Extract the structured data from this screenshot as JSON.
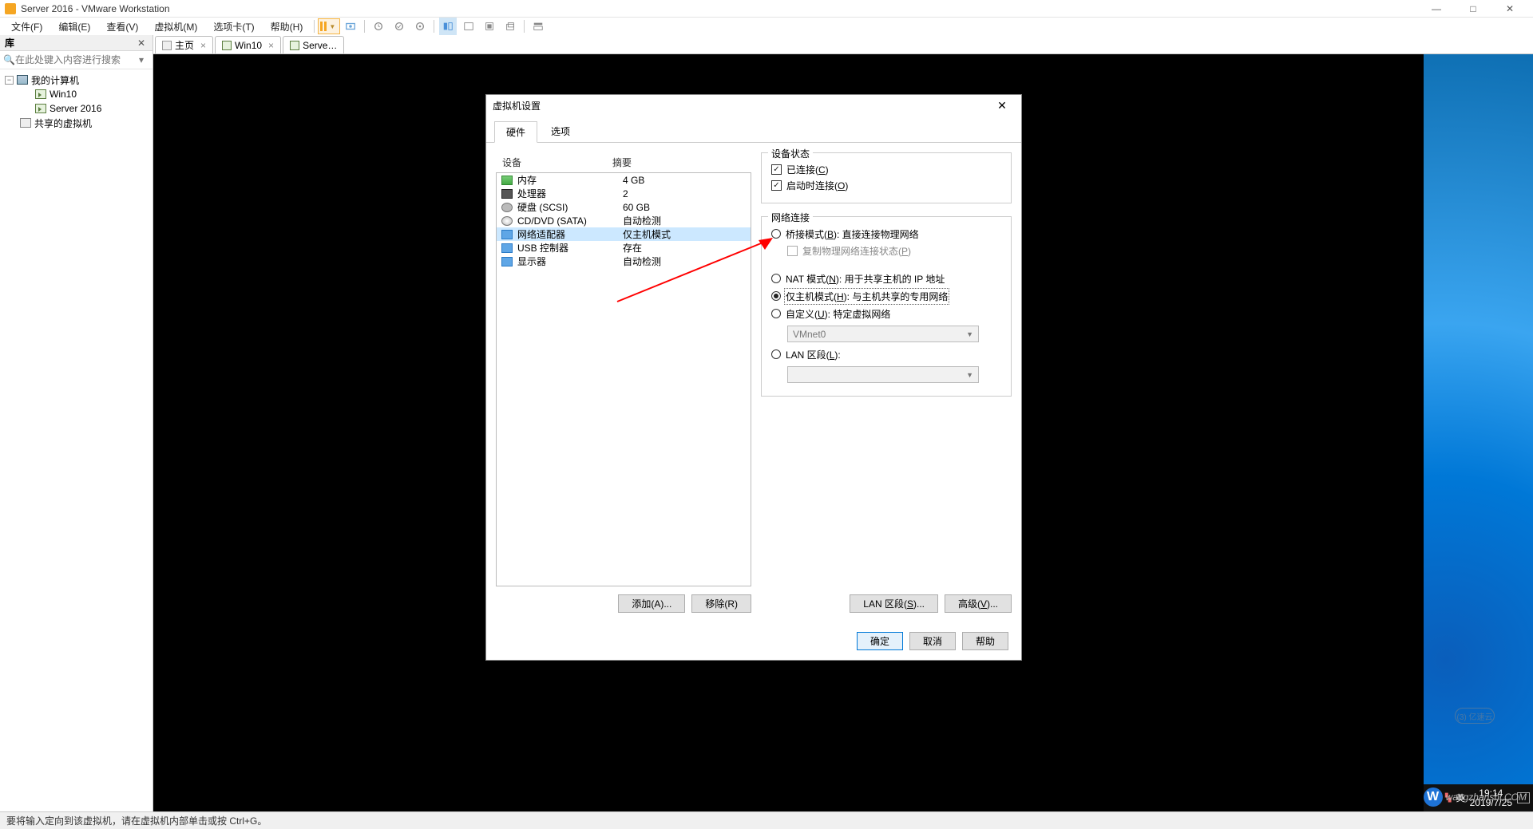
{
  "window": {
    "title": "Server 2016 - VMware Workstation",
    "min": "—",
    "max": "□",
    "close": "✕"
  },
  "menu": {
    "items": [
      "文件(F)",
      "编辑(E)",
      "查看(V)",
      "虚拟机(M)",
      "选项卡(T)",
      "帮助(H)"
    ]
  },
  "library": {
    "header": "库",
    "header_close": "✕",
    "search_placeholder": "在此处键入内容进行搜索",
    "root": "我的计算机",
    "children": [
      "Win10",
      "Server 2016"
    ],
    "shared": "共享的虚拟机"
  },
  "tabs": {
    "home": "主页",
    "win10": "Win10",
    "server": "Serve…",
    "x": "×"
  },
  "dialog": {
    "title": "虚拟机设置",
    "close": "✕",
    "tab_hw": "硬件",
    "tab_opt": "选项",
    "col_device": "设备",
    "col_summary": "摘要",
    "rows": [
      {
        "name": "内存",
        "summary": "4 GB",
        "cls": "mem"
      },
      {
        "name": "处理器",
        "summary": "2",
        "cls": "cpu"
      },
      {
        "name": "硬盘 (SCSI)",
        "summary": "60 GB",
        "cls": "disk"
      },
      {
        "name": "CD/DVD (SATA)",
        "summary": "自动检测",
        "cls": "cd"
      },
      {
        "name": "网络适配器",
        "summary": "仅主机模式",
        "cls": "net"
      },
      {
        "name": "USB 控制器",
        "summary": "存在",
        "cls": "usb"
      },
      {
        "name": "显示器",
        "summary": "自动检测",
        "cls": "disp"
      }
    ],
    "selected_index": 4,
    "btn_add": "添加(A)...",
    "btn_remove": "移除(R)",
    "state_legend": "设备状态",
    "chk_connected": "已连接(C)",
    "chk_power": "启动时连接(O)",
    "net_legend": "网络连接",
    "bridged": "桥接模式(B): 直接连接物理网络",
    "replicate": "复制物理网络连接状态(P)",
    "nat": "NAT 模式(N): 用于共享主机的 IP 地址",
    "host_only": "仅主机模式(H): 与主机共享的专用网络",
    "custom": "自定义(U): 特定虚拟网络",
    "vmnet": "VMnet0",
    "lan": "LAN 区段(L):",
    "lan_empty": "",
    "btn_lan_seg": "LAN 区段(S)...",
    "btn_adv": "高级(V)...",
    "btn_ok": "确定",
    "btn_cancel": "取消",
    "btn_help": "帮助"
  },
  "vm_taskbar": {
    "lang": "英",
    "time": "19:14",
    "date": "2019/7/25"
  },
  "statusbar": {
    "text": "要将输入定向到该虚拟机，请在虚拟机内部单击或按 Ctrl+G。"
  },
  "watermark": {
    "text": "wangzhanshi.COM",
    "yi": "(3) 亿速云"
  }
}
